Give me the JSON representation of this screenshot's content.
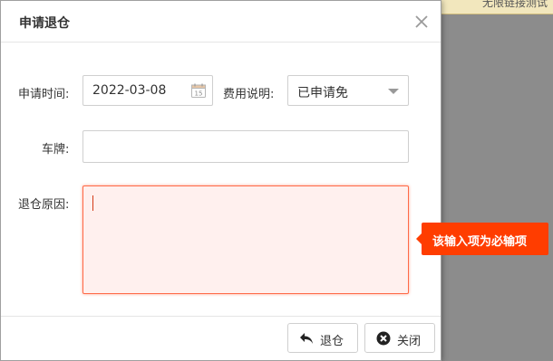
{
  "background": {
    "partial_text": "无限链接测试"
  },
  "dialog": {
    "title": "申请退仓",
    "close_icon": "close-icon"
  },
  "form": {
    "apply_time": {
      "label": "申请时间:",
      "value": "2022-03-08",
      "icon": "calendar-icon"
    },
    "fee_note": {
      "label": "费用说明:",
      "selected": "已申请免",
      "icon": "chevron-down-icon"
    },
    "plate": {
      "label": "车牌:",
      "value": ""
    },
    "reason": {
      "label": "退仓原因:",
      "value": ""
    }
  },
  "validation": {
    "message": "该输入项为必输项",
    "color": "#ff3d00"
  },
  "buttons": {
    "return_label": "退仓",
    "return_icon": "return-arrow-icon",
    "close_label": "关闭",
    "close_icon": "close-circle-icon"
  },
  "colors": {
    "error_border": "#ff6a47",
    "error_fill": "#fff0ee",
    "overlay": "#8c8c8c"
  }
}
